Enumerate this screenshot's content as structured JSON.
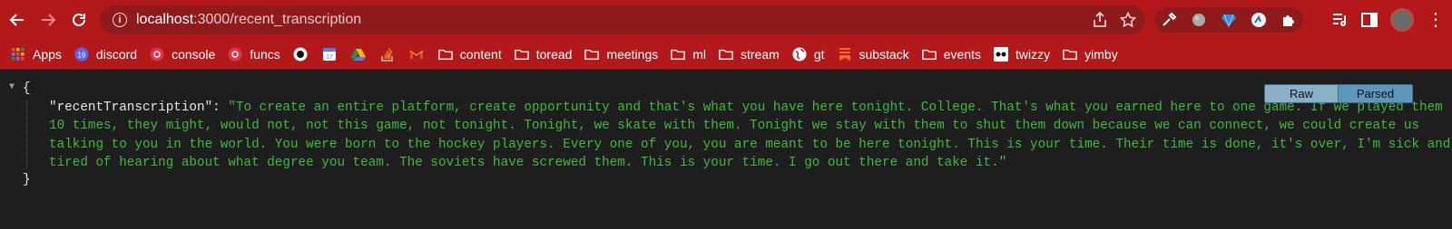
{
  "toolbar": {
    "back_icon": "arrow-left-icon",
    "forward_icon": "arrow-right-icon",
    "reload_icon": "reload-icon",
    "url_host": "localhost",
    "url_path": ":3000/recent_transcription"
  },
  "bookmarks": [
    {
      "label": "Apps",
      "icon": "apps-grid-icon"
    },
    {
      "label": "discord",
      "icon": "discord-icon"
    },
    {
      "label": "console",
      "icon": "console-icon"
    },
    {
      "label": "funcs",
      "icon": "funcs-icon"
    },
    {
      "label": "",
      "icon": "github-icon"
    },
    {
      "label": "",
      "icon": "calendar-icon"
    },
    {
      "label": "",
      "icon": "drive-icon"
    },
    {
      "label": "",
      "icon": "stackoverflow-icon"
    },
    {
      "label": "",
      "icon": "gmail-icon"
    },
    {
      "label": "content",
      "icon": "folder-icon"
    },
    {
      "label": "toread",
      "icon": "folder-icon"
    },
    {
      "label": "meetings",
      "icon": "folder-icon"
    },
    {
      "label": "ml",
      "icon": "folder-icon"
    },
    {
      "label": "stream",
      "icon": "folder-icon"
    },
    {
      "label": "gt",
      "icon": "globe-icon"
    },
    {
      "label": "substack",
      "icon": "substack-icon"
    },
    {
      "label": "events",
      "icon": "folder-icon"
    },
    {
      "label": "twizzy",
      "icon": "twizzy-icon"
    },
    {
      "label": "yimby",
      "icon": "folder-icon"
    }
  ],
  "json": {
    "open_brace": "{",
    "close_brace": "}",
    "key": "\"recentTranscription\"",
    "colon": ": ",
    "value": "\"To create an entire platform, create opportunity and that's what you have here tonight. College. That's what you earned here to one game. If we played them 10 times, they might, would not, not this game, not tonight. Tonight, we skate with them. Tonight we stay with them to shut them down because we can connect, we could create us talking to you in the world. You were born to the hockey players. Every one of you, you are meant to be here tonight. This is your time. Their time is done, it's over, I'm sick and tired of hearing about what degree you team. The soviets have screwed them. This is your time. I go out there and take it.\""
  },
  "view_toggle": {
    "raw_label": "Raw",
    "parsed_label": "Parsed",
    "selected": "Parsed"
  },
  "colors": {
    "toolbar_bg": "#b3191b",
    "viewer_bg": "#1e1e1e",
    "string_value": "#41b83c"
  }
}
